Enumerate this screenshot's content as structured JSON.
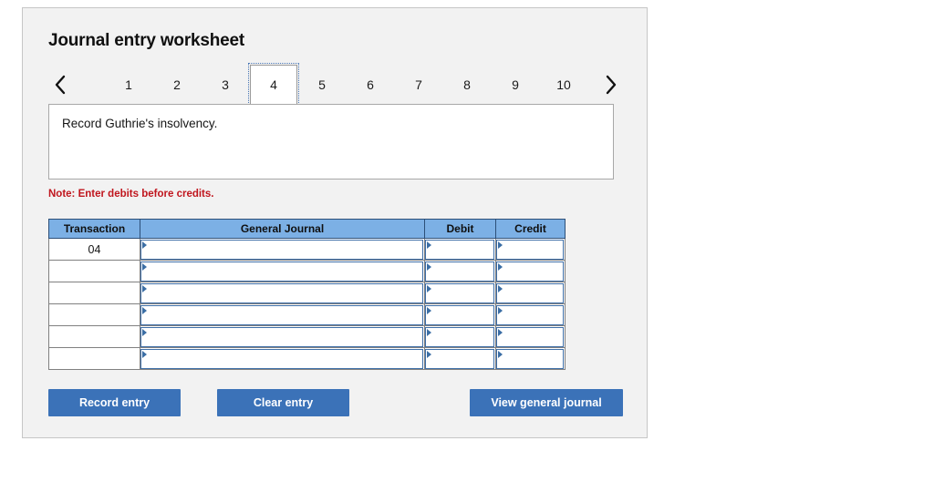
{
  "worksheet": {
    "title": "Journal entry worksheet",
    "description": "Record Guthrie's insolvency.",
    "note": "Note: Enter debits before credits."
  },
  "pager": {
    "prev_icon": "chevron-left-icon",
    "next_icon": "chevron-right-icon",
    "selected": "4",
    "tabs": [
      "1",
      "2",
      "3",
      "4",
      "5",
      "6",
      "7",
      "8",
      "9",
      "10"
    ]
  },
  "table": {
    "columns": [
      "Transaction",
      "General Journal",
      "Debit",
      "Credit"
    ],
    "rows": [
      {
        "transaction": "04",
        "general_journal": "",
        "debit": "",
        "credit": ""
      },
      {
        "transaction": "",
        "general_journal": "",
        "debit": "",
        "credit": ""
      },
      {
        "transaction": "",
        "general_journal": "",
        "debit": "",
        "credit": ""
      },
      {
        "transaction": "",
        "general_journal": "",
        "debit": "",
        "credit": ""
      },
      {
        "transaction": "",
        "general_journal": "",
        "debit": "",
        "credit": ""
      },
      {
        "transaction": "",
        "general_journal": "",
        "debit": "",
        "credit": ""
      }
    ]
  },
  "buttons": {
    "record": "Record entry",
    "clear": "Clear entry",
    "view_journal": "View general journal"
  },
  "colors": {
    "card_background": "#f2f2f2",
    "table_header_blue": "#7cb0e5",
    "button_blue": "#3b72b8",
    "note_red": "#c0161e",
    "input_border_blue": "#3f6fa8"
  }
}
